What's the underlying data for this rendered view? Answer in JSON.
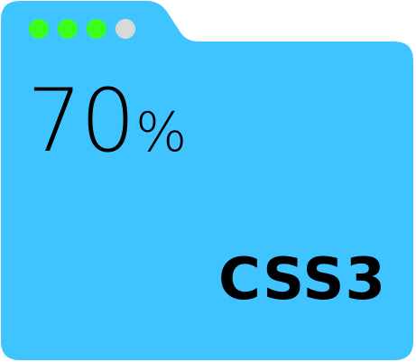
{
  "window": {
    "background_color": "#40c4ff",
    "traffic_dots": [
      {
        "color": "#39ff1a",
        "name": "green-dot-1"
      },
      {
        "color": "#39ff1a",
        "name": "green-dot-2"
      },
      {
        "color": "#39ff1a",
        "name": "green-dot-3"
      },
      {
        "color": "#d9d9d9",
        "name": "gray-dot"
      }
    ]
  },
  "progress": {
    "value": "70",
    "unit": "%"
  },
  "skill": {
    "label": "CSS3"
  }
}
